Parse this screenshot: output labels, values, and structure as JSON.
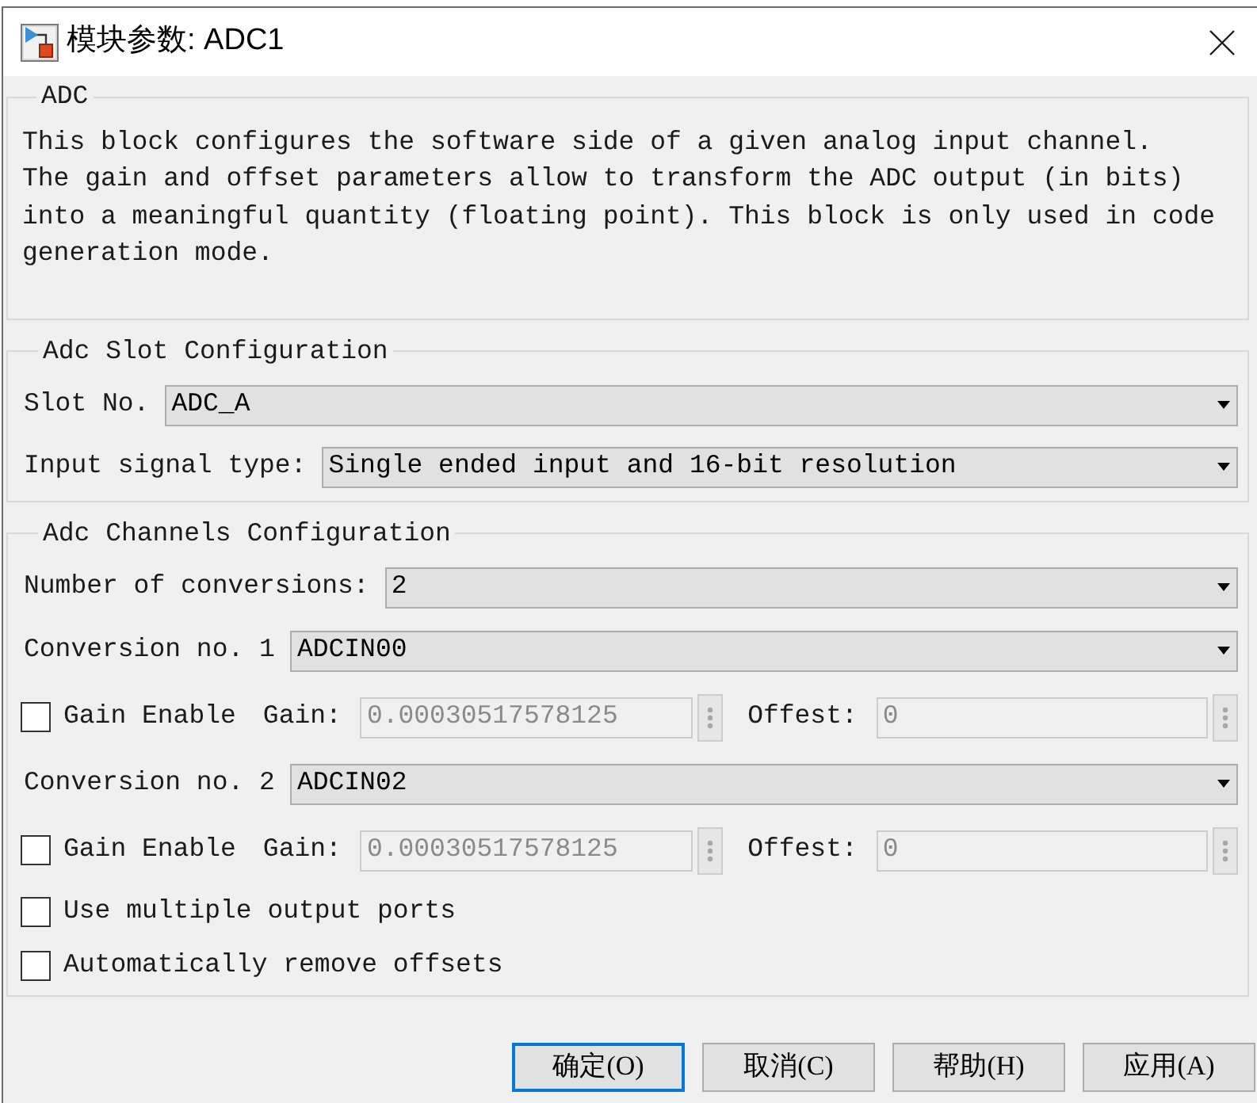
{
  "window": {
    "title": "模块参数: ADC1"
  },
  "description_group": {
    "legend": "ADC",
    "text": "This block configures the software side of a given analog input channel.\nThe gain and offset parameters allow to transform the ADC output (in bits) into a meaningful quantity (floating point). This block is only used in code generation mode."
  },
  "slot_group": {
    "legend": "Adc Slot Configuration",
    "fields": [
      {
        "label": "Slot No.",
        "value": "ADC_A"
      },
      {
        "label": "Input signal type:",
        "value": "Single ended input and 16-bit resolution"
      }
    ]
  },
  "channels_group": {
    "legend": "Adc Channels Configuration",
    "rows": [
      {
        "kind": "dropdown",
        "label": "Number of conversions:",
        "value": "2"
      },
      {
        "kind": "dropdown",
        "label": "Conversion no. 1",
        "value": "ADCIN00"
      },
      {
        "kind": "gain",
        "label": "Gain Enable",
        "checked": false,
        "gain_label": "Gain:",
        "gain_value": "0.00030517578125",
        "offset_label": "Offest:",
        "offset_value": "0",
        "disabled": true
      },
      {
        "kind": "dropdown",
        "label": "Conversion no. 2",
        "value": "ADCIN02"
      },
      {
        "kind": "gain",
        "label": "Gain Enable",
        "checked": false,
        "gain_label": "Gain:",
        "gain_value": "0.00030517578125",
        "offset_label": "Offest:",
        "offset_value": "0",
        "disabled": true
      },
      {
        "kind": "checkbox",
        "label": "Use multiple output ports",
        "checked": false
      },
      {
        "kind": "checkbox",
        "label": "Automatically remove offsets",
        "checked": false
      }
    ]
  },
  "buttons": [
    {
      "label": "确定(O)",
      "focused": true
    },
    {
      "label": "取消(C)",
      "focused": false
    },
    {
      "label": "帮助(H)",
      "focused": false
    },
    {
      "label": "应用(A)",
      "focused": false
    }
  ]
}
